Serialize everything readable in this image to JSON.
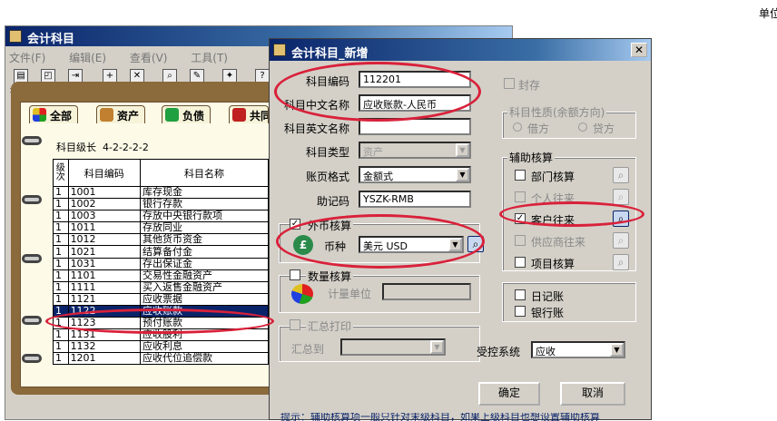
{
  "top_right_text": "单位",
  "bg_window": {
    "title": "会计科目",
    "menu": [
      "文件(F)",
      "编辑(E)",
      "查看(V)",
      "工具(T)"
    ],
    "toolbar": [
      "打印",
      "预览",
      "输出",
      "增加",
      "删除",
      "查找",
      "修改",
      "定义",
      "帮助"
    ],
    "tabs": [
      "全部",
      "资产",
      "负债",
      "共同"
    ],
    "level_label": "科目级长",
    "level_value": "4-2-2-2-2",
    "table": {
      "headers": [
        "级次",
        "科目编码",
        "科目名称"
      ],
      "rows": [
        [
          "1",
          "1001",
          "库存现金"
        ],
        [
          "1",
          "1002",
          "银行存款"
        ],
        [
          "1",
          "1003",
          "存放中央银行款项"
        ],
        [
          "1",
          "1011",
          "存放同业"
        ],
        [
          "1",
          "1012",
          "其他货币资金"
        ],
        [
          "1",
          "1021",
          "结算备付金"
        ],
        [
          "1",
          "1031",
          "存出保证金"
        ],
        [
          "1",
          "1101",
          "交易性金融资产"
        ],
        [
          "1",
          "1111",
          "买入返售金融资产"
        ],
        [
          "1",
          "1121",
          "应收票据"
        ],
        [
          "1",
          "1122",
          "应收账款"
        ],
        [
          "1",
          "1123",
          "预付账款"
        ],
        [
          "1",
          "1131",
          "应收股利"
        ],
        [
          "1",
          "1132",
          "应收利息"
        ],
        [
          "1",
          "1201",
          "应收代位追偿款"
        ]
      ],
      "selected_index": 10
    }
  },
  "dialog": {
    "title": "会计科目_新增",
    "labels": {
      "code": "科目编码",
      "cn_name": "科目中文名称",
      "en_name": "科目英文名称",
      "type": "科目类型",
      "format": "账页格式",
      "mnemonic": "助记码",
      "foreign": "外币核算",
      "currency": "币种",
      "quantity": "数量核算",
      "unit": "计量单位",
      "summary_print": "汇总打印",
      "summary_to": "汇总到",
      "sealed": "封存",
      "nature": "科目性质(余额方向)",
      "debit": "借方",
      "credit": "贷方",
      "aux": "辅助核算",
      "dept": "部门核算",
      "personal": "个人往来",
      "customer": "客户往来",
      "supplier": "供应商往来",
      "project": "项目核算",
      "journal": "日记账",
      "bank": "银行账",
      "controlled": "受控系统"
    },
    "values": {
      "code": "112201",
      "cn_name": "应收账款-人民币",
      "en_name": "",
      "type": "资产",
      "format": "金额式",
      "mnemonic": "YSZK-RMB",
      "currency": "美元 USD",
      "unit": "",
      "summary_to": "",
      "controlled": "应收"
    },
    "checks": {
      "foreign": true,
      "quantity": false,
      "customer": true,
      "dept": false,
      "project": false,
      "journal": false,
      "bank": false
    },
    "ok": "确定",
    "cancel": "取消",
    "hint": "提示：辅助核算项一般只针对末级科目，如果上级科目也想设置辅助核算"
  },
  "colors": {
    "title_bar": "#0a246a",
    "highlight": "#d9213a",
    "selection": "#0a246a"
  }
}
